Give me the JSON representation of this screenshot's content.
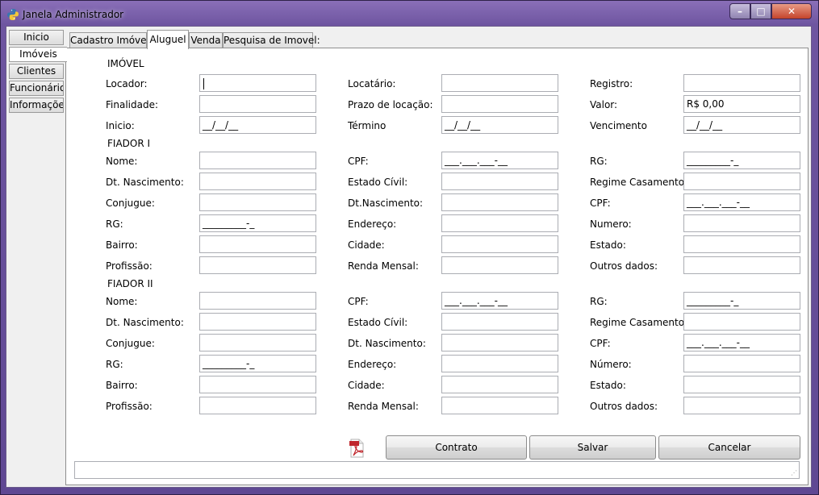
{
  "window": {
    "title": "Janela Administrador",
    "controls": {
      "minimize": "–",
      "maximize": "□",
      "close": "✕"
    }
  },
  "sidebar": {
    "tabs": [
      {
        "label": "Inicio"
      },
      {
        "label": "Imóveis"
      },
      {
        "label": "Clientes"
      },
      {
        "label": "Funcionário"
      },
      {
        "label": "Informações"
      }
    ],
    "active_index": 1
  },
  "tabs": {
    "items": [
      {
        "label": "Cadastro Imóvel"
      },
      {
        "label": "Aluguel"
      },
      {
        "label": "Venda"
      },
      {
        "label": "Pesquisa de Imovel:"
      }
    ],
    "active_index": 1
  },
  "imovel": {
    "section_title": "IMÓVEL",
    "locador": {
      "label": "Locador:",
      "value": ""
    },
    "locatario": {
      "label": "Locatário:",
      "value": ""
    },
    "registro": {
      "label": "Registro:",
      "value": ""
    },
    "finalidade": {
      "label": "Finalidade:",
      "value": ""
    },
    "prazo": {
      "label": "Prazo de locação:",
      "value": ""
    },
    "valor": {
      "label": "Valor:",
      "value": "R$ 0,00"
    },
    "inicio": {
      "label": "Inicio:",
      "value": "__/__/__"
    },
    "termino": {
      "label": "Término",
      "value": "__/__/__"
    },
    "vencimento": {
      "label": "Vencimento",
      "value": "__/__/__"
    }
  },
  "fiador1": {
    "section_title": "FIADOR I",
    "nome": {
      "label": "Nome:",
      "value": ""
    },
    "cpf": {
      "label": "CPF:",
      "value": "___.___.___-__"
    },
    "rg": {
      "label": "RG:",
      "value": "_________-_"
    },
    "dt_nascimento": {
      "label": "Dt. Nascimento:",
      "value": ""
    },
    "estado_civil": {
      "label": "Estado Cívil:",
      "value": ""
    },
    "regime": {
      "label": "Regime Casamento:",
      "value": ""
    },
    "conjugue": {
      "label": "Conjugue:",
      "value": ""
    },
    "conj_nascimento": {
      "label": "Dt.Nascimento:",
      "value": ""
    },
    "conj_cpf": {
      "label": "CPF:",
      "value": "___.___.___-__"
    },
    "conj_rg": {
      "label": "RG:",
      "value": "_________-_"
    },
    "endereco": {
      "label": "Endereço:",
      "value": ""
    },
    "numero": {
      "label": "Numero:",
      "value": ""
    },
    "bairro": {
      "label": "Bairro:",
      "value": ""
    },
    "cidade": {
      "label": "Cidade:",
      "value": ""
    },
    "estado": {
      "label": "Estado:",
      "value": ""
    },
    "profissao": {
      "label": "Profissão:",
      "value": ""
    },
    "renda": {
      "label": "Renda Mensal:",
      "value": ""
    },
    "outros": {
      "label": "Outros dados:",
      "value": ""
    }
  },
  "fiador2": {
    "section_title": "FIADOR II",
    "nome": {
      "label": "Nome:",
      "value": ""
    },
    "cpf": {
      "label": "CPF:",
      "value": "___.___.___-__"
    },
    "rg": {
      "label": "RG:",
      "value": "_________-_"
    },
    "dt_nascimento": {
      "label": "Dt. Nascimento:",
      "value": ""
    },
    "estado_civil": {
      "label": "Estado Cívil:",
      "value": ""
    },
    "regime": {
      "label": "Regime Casamento:",
      "value": ""
    },
    "conjugue": {
      "label": "Conjugue:",
      "value": ""
    },
    "conj_nascimento": {
      "label": "Dt. Nascimento:",
      "value": ""
    },
    "conj_cpf": {
      "label": "CPF:",
      "value": "___.___.___-__"
    },
    "conj_rg": {
      "label": "RG:",
      "value": "_________-_"
    },
    "endereco": {
      "label": "Endereço:",
      "value": ""
    },
    "numero": {
      "label": "Número:",
      "value": ""
    },
    "bairro": {
      "label": "Bairro:",
      "value": ""
    },
    "cidade": {
      "label": "Cidade:",
      "value": ""
    },
    "estado": {
      "label": "Estado:",
      "value": ""
    },
    "profissao": {
      "label": "Profissão:",
      "value": ""
    },
    "renda": {
      "label": "Renda Mensal:",
      "value": ""
    },
    "outros": {
      "label": "Outros dados:",
      "value": ""
    }
  },
  "actions": {
    "contrato": "Contrato",
    "salvar": "Salvar",
    "cancelar": "Cancelar",
    "pdf_icon": "pdf-icon"
  },
  "status": {
    "text": ""
  }
}
